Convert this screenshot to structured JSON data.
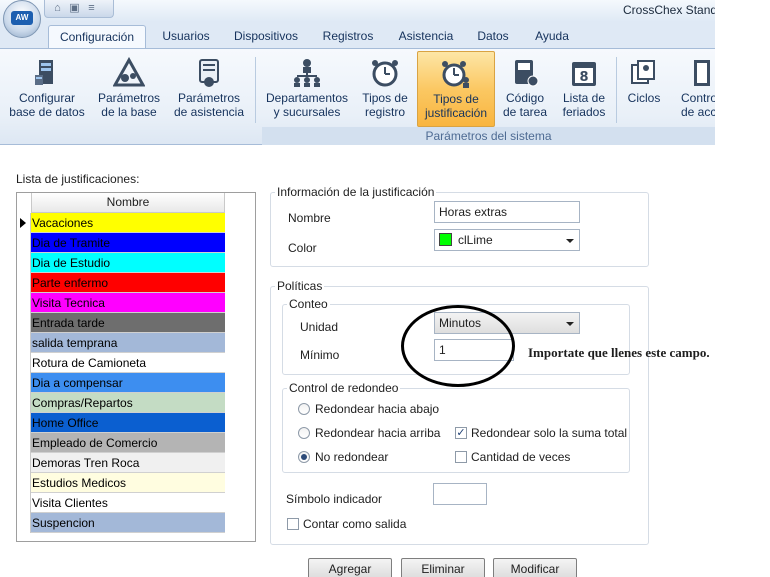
{
  "app": {
    "title": "CrossChex Standard",
    "logo": "AW"
  },
  "quick_access": [
    "home-icon",
    "device-icon",
    "dropdown-icon"
  ],
  "tabs": [
    {
      "label": "Configuración",
      "active": true
    },
    {
      "label": "Usuarios"
    },
    {
      "label": "Dispositivos"
    },
    {
      "label": "Registros"
    },
    {
      "label": "Asistencia"
    },
    {
      "label": "Datos"
    },
    {
      "label": "Ayuda"
    }
  ],
  "ribbon": {
    "buttons": [
      {
        "label": "Configurar\nbase de datos",
        "icon": "database-server-icon"
      },
      {
        "label": "Parámetros\nde la base",
        "icon": "triangle-gears-icon"
      },
      {
        "label": "Parámetros\nde asistencia",
        "icon": "scroll-gear-icon"
      },
      {
        "label": "Departamentos\ny sucursales",
        "icon": "org-chart-icon"
      },
      {
        "label": "Tipos de\nregistro",
        "icon": "alarm-clock-icon"
      },
      {
        "label": "Tipos de\njustificación",
        "icon": "alarm-clock-person-icon",
        "active": true
      },
      {
        "label": "Código\nde tarea",
        "icon": "task-code-icon"
      },
      {
        "label": "Lista de\nferiados",
        "icon": "calendar-8-icon"
      },
      {
        "label": "Ciclos",
        "icon": "cycles-icon"
      },
      {
        "label": "Control\nde acce",
        "icon": "door-icon"
      }
    ],
    "group_caption": "Parámetros del sistema"
  },
  "list": {
    "caption": "Lista de justificaciones:",
    "header": "Nombre",
    "rows": [
      {
        "name": "Vacaciones",
        "bg": "#ffff00",
        "fg": "#000000"
      },
      {
        "name": "Dia de Tramite",
        "bg": "#0000ff",
        "fg": "#000000"
      },
      {
        "name": "Dia de Estudio",
        "bg": "#00ffff",
        "fg": "#000000"
      },
      {
        "name": "Parte enfermo",
        "bg": "#ff0000",
        "fg": "#000000"
      },
      {
        "name": "Visita Tecnica",
        "bg": "#ff00ff",
        "fg": "#000000"
      },
      {
        "name": "Entrada tarde",
        "bg": "#6e6e6e",
        "fg": "#000000"
      },
      {
        "name": "salida temprana",
        "bg": "#a3b8d8",
        "fg": "#000000"
      },
      {
        "name": "Rotura de Camioneta",
        "bg": "#ffffff",
        "fg": "#000000"
      },
      {
        "name": "Dia a compensar",
        "bg": "#3d8ef0",
        "fg": "#000000"
      },
      {
        "name": "Compras/Repartos",
        "bg": "#c4dcc4",
        "fg": "#000000"
      },
      {
        "name": "Home Office",
        "bg": "#0b5fd0",
        "fg": "#000000"
      },
      {
        "name": "Empleado de Comercio",
        "bg": "#b4b4b4",
        "fg": "#000000"
      },
      {
        "name": "Demoras Tren Roca",
        "bg": "#f0f0f0",
        "fg": "#000000"
      },
      {
        "name": "Estudios Medicos",
        "bg": "#fffde0",
        "fg": "#000000"
      },
      {
        "name": "Visita Clientes",
        "bg": "#ffffff",
        "fg": "#000000"
      },
      {
        "name": "Suspencion",
        "bg": "#a3b8d8",
        "fg": "#000000"
      }
    ]
  },
  "info": {
    "legend": "Información de la justificación",
    "name_label": "Nombre",
    "name_value": "Horas extras",
    "color_label": "Color",
    "color_value": "clLime",
    "color_hex": "#00ff00"
  },
  "policies": {
    "legend": "Políticas",
    "count": {
      "legend": "Conteo",
      "unit_label": "Unidad",
      "unit_value": "Minutos",
      "min_label": "Mínimo",
      "min_value": "1"
    },
    "rounding": {
      "legend": "Control de redondeo",
      "round_down": "Redondear hacia abajo",
      "round_up": "Redondear hacia arriba",
      "no_round": "No redondear",
      "sum_only": "Redondear solo la suma total",
      "times": "Cantidad de veces"
    },
    "symbol_label": "Símbolo indicador",
    "symbol_value": "",
    "count_exit": "Contar como salida"
  },
  "buttons": {
    "add": "Agregar",
    "delete": "Eliminar",
    "modify": "Modificar"
  },
  "annotation": "Importate que llenes este campo."
}
